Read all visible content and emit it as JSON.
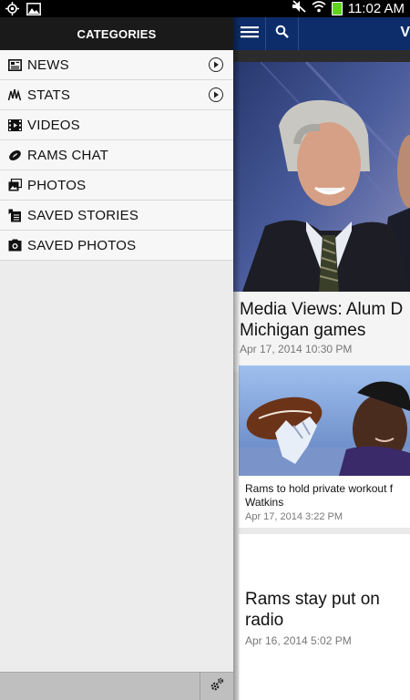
{
  "status_bar": {
    "time": "11:02 AM",
    "icons": [
      "location-icon",
      "image-icon",
      "mute-icon",
      "wifi-icon",
      "battery-icon"
    ],
    "battery_color": "#5fd21f"
  },
  "drawer": {
    "title": "CATEGORIES",
    "items": [
      {
        "label": "NEWS",
        "icon": "newspaper-icon",
        "has_chevron": true
      },
      {
        "label": "STATS",
        "icon": "stats-icon",
        "has_chevron": true
      },
      {
        "label": "VIDEOS",
        "icon": "video-icon",
        "has_chevron": false
      },
      {
        "label": "RAMS CHAT",
        "icon": "football-icon",
        "has_chevron": false
      },
      {
        "label": "PHOTOS",
        "icon": "photos-icon",
        "has_chevron": false
      },
      {
        "label": "SAVED STORIES",
        "icon": "saved-stories-icon",
        "has_chevron": false
      },
      {
        "label": "SAVED PHOTOS",
        "icon": "saved-photos-icon",
        "has_chevron": false
      }
    ],
    "footer": {
      "icon": "settings-icon"
    }
  },
  "main": {
    "appbar_color": "#0d2d6a",
    "brand_partial": "V",
    "articles": [
      {
        "title": "Media Views: Alum D",
        "title_line2": "Michigan games",
        "date": "Apr 17, 2014 10:30 PM"
      },
      {
        "title": "Rams to hold private workout f",
        "title_line2": "Watkins",
        "date": "Apr 17, 2014 3:22 PM"
      },
      {
        "title": "Rams stay put on",
        "title_line2": "radio",
        "date": "Apr 16, 2014 5:02 PM"
      }
    ]
  }
}
